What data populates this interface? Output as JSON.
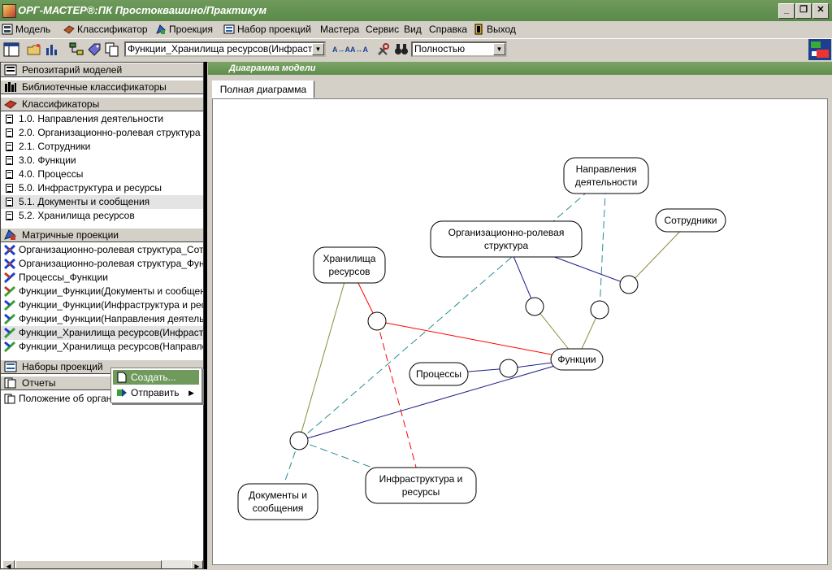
{
  "window": {
    "title": "ОРГ-МАСТЕР®:ПК Простоквашино/Практикум",
    "minimize": "_",
    "restore": "❐",
    "close": "✕"
  },
  "menubar": {
    "items": [
      "Модель",
      "Классификатор",
      "Проекция",
      "Набор проекций",
      "Мастера",
      "Сервис",
      "Вид",
      "Справка",
      "Выход"
    ]
  },
  "toolbar": {
    "projection_combo": "Функции_Хранилища ресурсов(Инфраст",
    "font_smaller": "A↔A",
    "font_larger": "A↔A",
    "zoom_combo": "Полностью"
  },
  "left_pane": {
    "section_repository": "Репозитарий моделей",
    "section_library": "Библиотечные классификаторы",
    "section_classifiers": "Классификаторы",
    "classifiers": [
      "1.0. Направления деятельности",
      "2.0. Организационно-ролевая структура",
      "2.1. Сотрудники",
      "3.0. Функции",
      "4.0. Процессы",
      "5.0. Инфраструктура и ресурсы",
      "5.1. Документы и сообщения",
      "5.2. Хранилища ресурсов"
    ],
    "selected_classifier": "5.1. Документы и сообщения",
    "section_matrix": "Матричные проекции",
    "matrix_projections": [
      "Организационно-ролевая структура_Сотрудники",
      "Организационно-ролевая структура_Функции",
      "Процессы_Функции",
      "Функции_Функции(Документы и сообщения)",
      "Функции_Функции(Инфраструктура и ресурсы)",
      "Функции_Функции(Направления деятельности)",
      "Функции_Хранилища ресурсов(Инфраструктура и ресурсы)",
      "Функции_Хранилища ресурсов(Направления деятельности)"
    ],
    "section_projection_sets": "Наборы проекций",
    "section_reports": "Отчеты",
    "reports": [
      "Положение об организационной структуре"
    ]
  },
  "context_menu": {
    "items": [
      "Создать...",
      "Отправить"
    ],
    "highlighted": "Создать..."
  },
  "diagram": {
    "header": "Диаграмма модели",
    "tab": "Полная диаграмма",
    "nodes": {
      "directions": [
        "Направления",
        "деятельности"
      ],
      "employees": [
        "Сотрудники"
      ],
      "org_structure": [
        "Организационно-ролевая",
        "структура"
      ],
      "storages": [
        "Хранилища",
        "ресурсов"
      ],
      "functions": [
        "Функции"
      ],
      "processes": [
        "Процессы"
      ],
      "infrastructure": [
        "Инфраструктура и",
        "ресурсы"
      ],
      "documents": [
        "Документы и",
        "сообщения"
      ]
    },
    "colors": {
      "red": "#ff0000",
      "blue": "#1e1e8c",
      "teal": "#2a8c94",
      "olive": "#8c8c3c"
    }
  }
}
